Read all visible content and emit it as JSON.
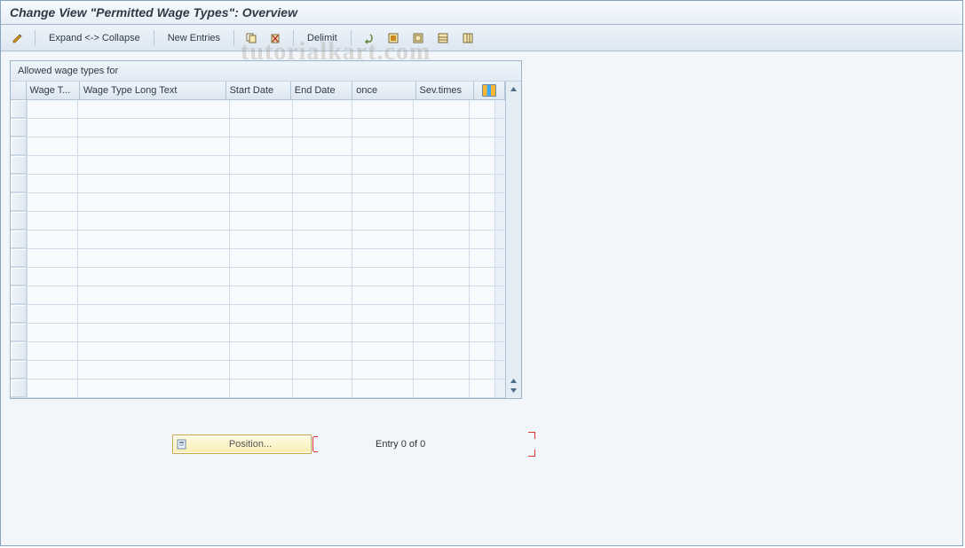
{
  "title": "Change View \"Permitted Wage Types\": Overview",
  "toolbar": {
    "expand_collapse": "Expand <-> Collapse",
    "new_entries": "New Entries",
    "delimit": "Delimit"
  },
  "panel": {
    "title": "Allowed wage types for"
  },
  "columns": {
    "wage_type": "Wage T...",
    "wage_type_long": "Wage Type Long Text",
    "start_date": "Start Date",
    "end_date": "End Date",
    "once": "once",
    "sev_times": "Sev.times"
  },
  "footer": {
    "position_label": "Position...",
    "entry_text": "Entry 0 of 0"
  },
  "row_count": 16,
  "watermark": "tutorialkart.com"
}
